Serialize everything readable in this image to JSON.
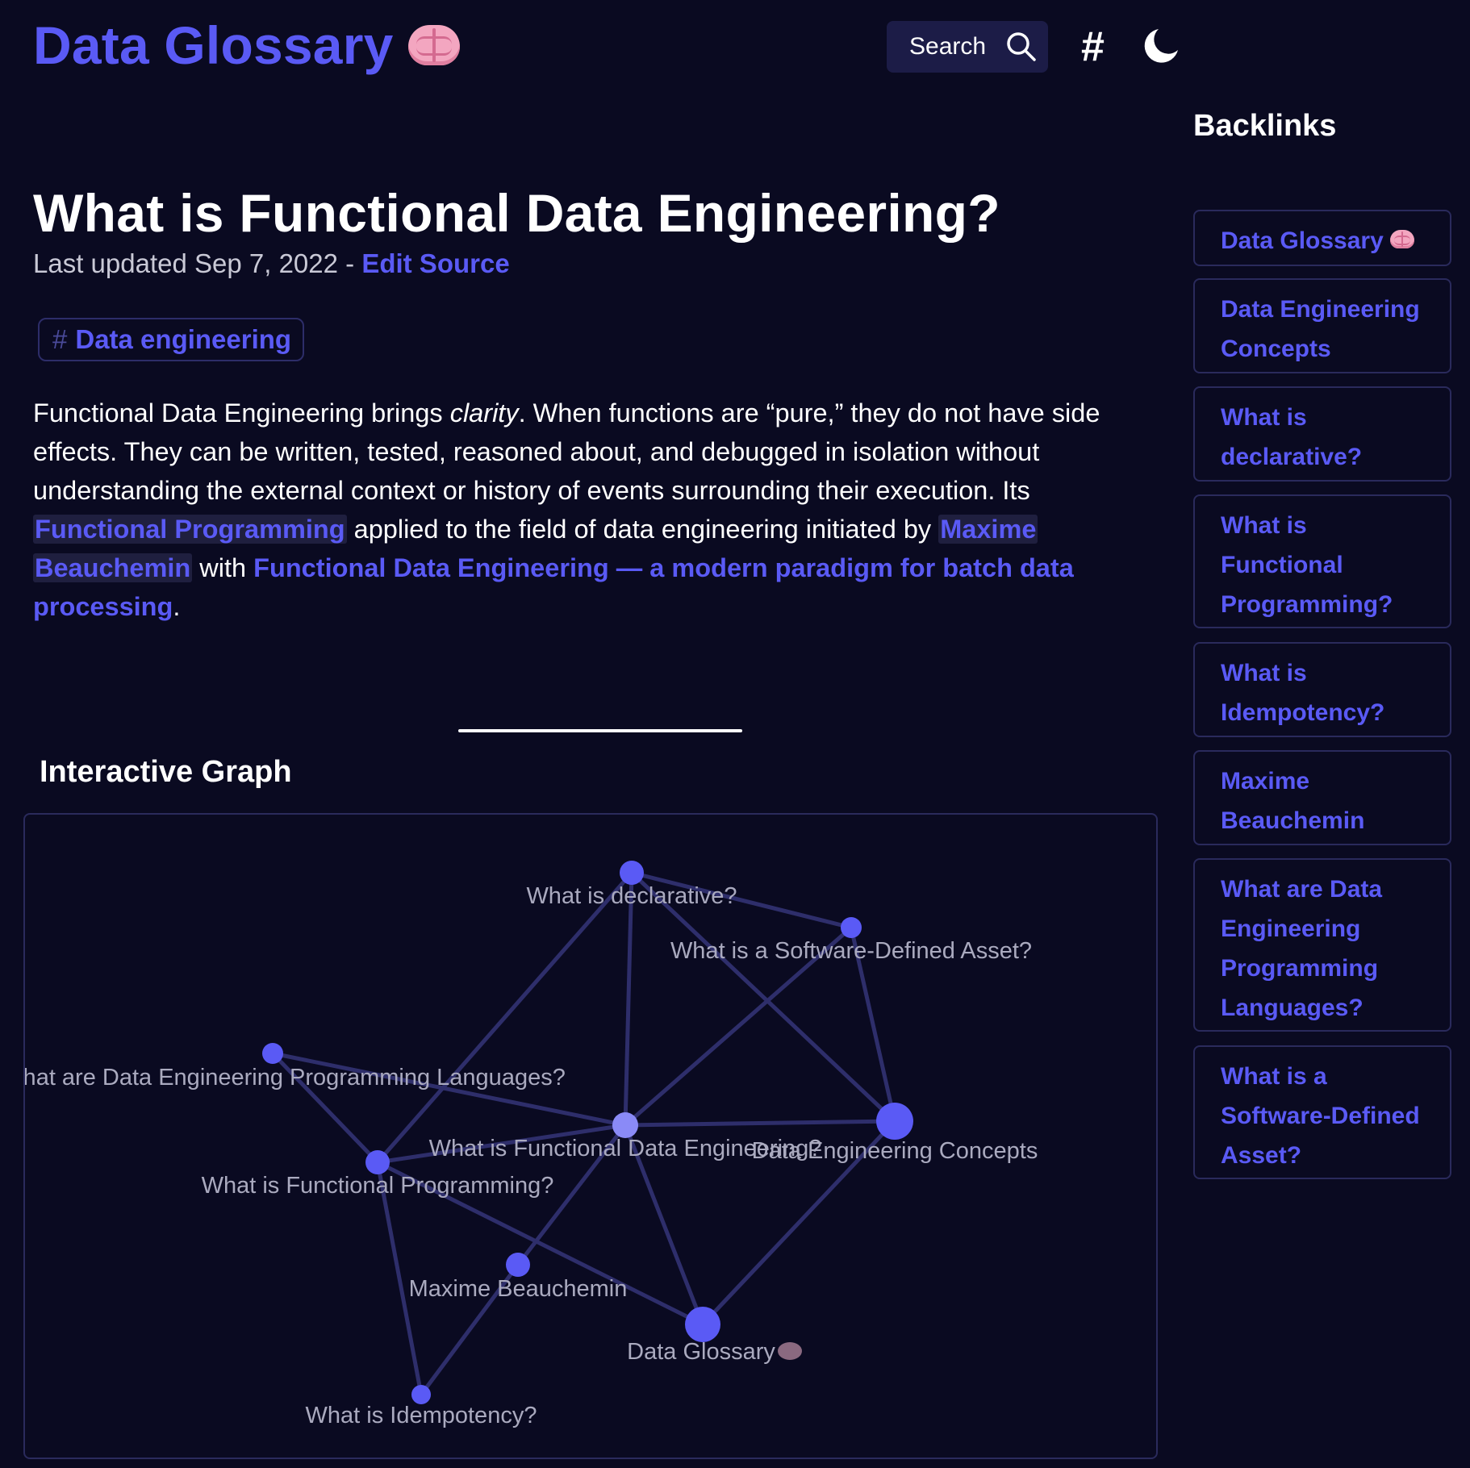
{
  "header": {
    "site_title": "Data Glossary",
    "search_label": "Search",
    "hashtag_label": "#",
    "icons": {
      "site": "brain-icon",
      "search": "search-icon",
      "theme": "moon-icon"
    }
  },
  "article": {
    "title": "What is Functional Data Engineering?",
    "meta_prefix": "Last updated Sep 7, 2022 - ",
    "edit_source": "Edit Source",
    "tag": {
      "hash": "#",
      "label": "Data engineering"
    },
    "body": {
      "l1_a": "Functional Data Engineering brings ",
      "l1_em": "clarity",
      "l1_b": ". When functions are “pure,” they do not have side",
      "l2": "effects. They can be written, tested, reasoned about, and debugged in isolation without",
      "l3": "understanding the external context or history of events surrounding their execution. Its",
      "link_fp": "Functional Programming",
      "l4_mid": " applied to the field of data engineering initiated by ",
      "link_maxime_1": "Maxime",
      "link_maxime_2": "Beauchemin",
      "l5_mid": " with ",
      "link_fde_1": "Functional Data Engineering — a modern paradigm for batch data",
      "link_fde_2": "processing",
      "end": "."
    }
  },
  "graph": {
    "heading": "Interactive Graph",
    "nodes": [
      {
        "id": "declarative",
        "label": "What is declarative?"
      },
      {
        "id": "sda",
        "label": "What is a Software-Defined Asset?"
      },
      {
        "id": "langs",
        "label": "What are Data Engineering Programming Languages?"
      },
      {
        "id": "fde",
        "label": "What is Functional Data Engineering?"
      },
      {
        "id": "concepts",
        "label": "Data Engineering Concepts"
      },
      {
        "id": "fp",
        "label": "What is Functional Programming?"
      },
      {
        "id": "maxime",
        "label": "Maxime Beauchemin"
      },
      {
        "id": "glossary",
        "label": "Data Glossary"
      },
      {
        "id": "idempotency",
        "label": "What is Idempotency?"
      }
    ],
    "edges": [
      [
        "declarative",
        "sda"
      ],
      [
        "declarative",
        "concepts"
      ],
      [
        "declarative",
        "fde"
      ],
      [
        "declarative",
        "fp"
      ],
      [
        "sda",
        "fde"
      ],
      [
        "sda",
        "concepts"
      ],
      [
        "langs",
        "fp"
      ],
      [
        "langs",
        "fde"
      ],
      [
        "fde",
        "concepts"
      ],
      [
        "fde",
        "fp"
      ],
      [
        "fde",
        "maxime"
      ],
      [
        "fde",
        "glossary"
      ],
      [
        "fp",
        "glossary"
      ],
      [
        "fp",
        "idempotency"
      ],
      [
        "maxime",
        "idempotency"
      ],
      [
        "concepts",
        "glossary"
      ]
    ],
    "colors": {
      "node": "#5a5af5",
      "node_current": "#8a8af7",
      "edge": "#2e2e6b",
      "label": "#aaaabf"
    }
  },
  "backlinks": {
    "heading": "Backlinks",
    "items": [
      {
        "label": "Data Glossary",
        "icon": "brain-icon"
      },
      {
        "label": "Data Engineering\nConcepts"
      },
      {
        "label": "What is\ndeclarative?"
      },
      {
        "label": "What is\nFunctional\nProgramming?"
      },
      {
        "label": "What is\nIdempotency?"
      },
      {
        "label": "Maxime\nBeauchemin"
      },
      {
        "label": "What are Data\nEngineering\nProgramming\nLanguages?"
      },
      {
        "label": "What is a\nSoftware-Defined\nAsset?"
      }
    ]
  },
  "colors": {
    "background": "#0a0a21",
    "accent": "#5a5af5",
    "text": "#ffffff",
    "muted": "#c9c9d6",
    "border": "#2a2a5c"
  }
}
